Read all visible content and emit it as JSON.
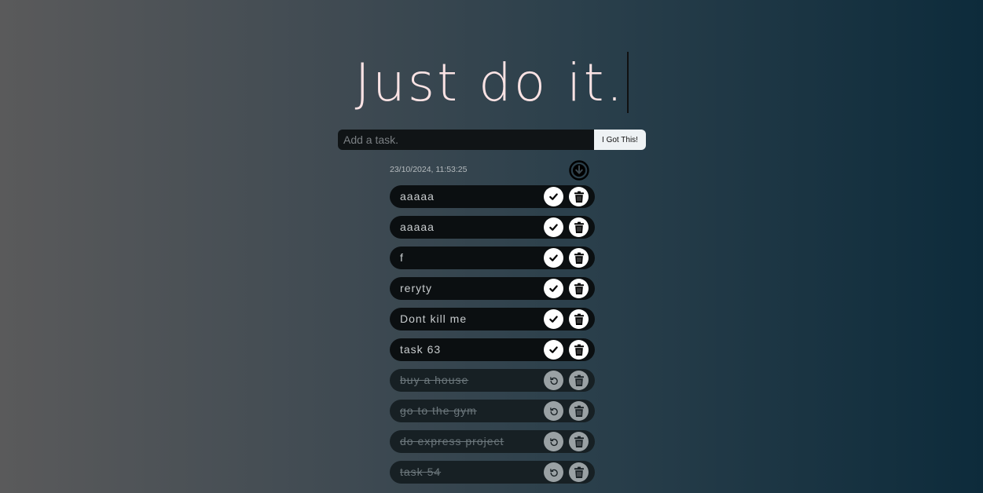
{
  "header": {
    "title": "Just do it."
  },
  "add_form": {
    "placeholder": "Add a task.",
    "value": "",
    "button_label": "I Got This!"
  },
  "meta": {
    "timestamp": "23/10/2024, 11:53:25",
    "download_icon": "download-circle-icon"
  },
  "tasks": [
    {
      "text": "aaaaa",
      "completed": false
    },
    {
      "text": "aaaaa",
      "completed": false
    },
    {
      "text": "f",
      "completed": false
    },
    {
      "text": "reryty",
      "completed": false
    },
    {
      "text": "Dont kill me",
      "completed": false
    },
    {
      "text": "task 63",
      "completed": false
    },
    {
      "text": "buy a house",
      "completed": true
    },
    {
      "text": "go to the gym",
      "completed": true
    },
    {
      "text": "do express project",
      "completed": true
    },
    {
      "text": "task 54",
      "completed": true
    }
  ],
  "icons": {
    "complete": "check-icon",
    "undo": "undo-icon",
    "delete": "trash-icon"
  },
  "colors": {
    "title": "#fbe3e4",
    "active_task_bg": "#0b0f11",
    "done_task_bg": "#172024",
    "done_text": "#6c777c"
  }
}
